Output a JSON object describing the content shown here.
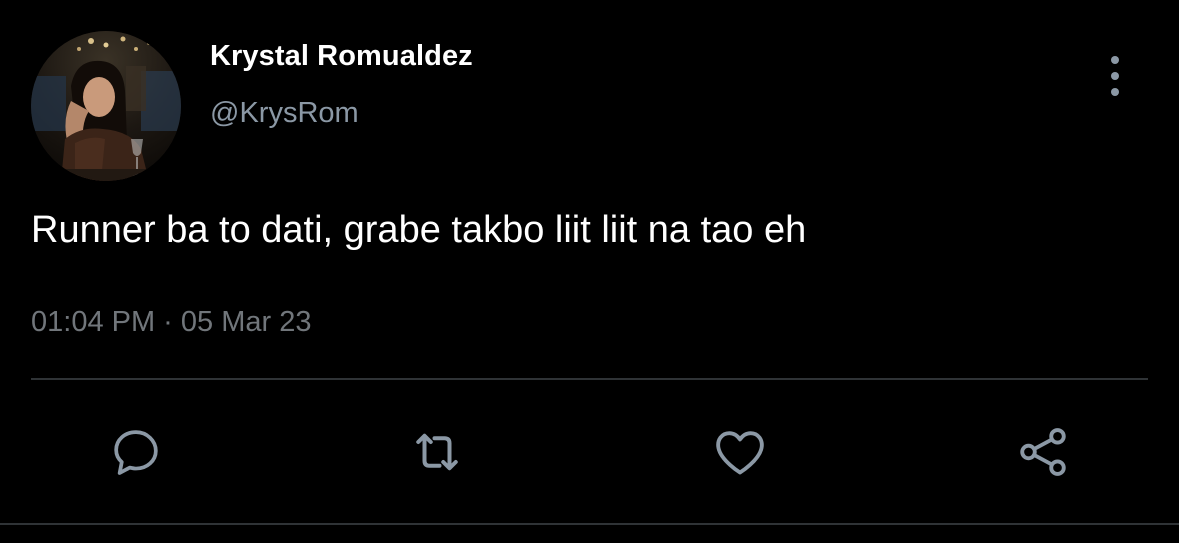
{
  "tweet": {
    "author": {
      "display_name": "Krystal Romualdez",
      "handle": "@KrysRom"
    },
    "text": "Runner ba to dati, grabe takbo liit liit na tao eh",
    "timestamp": "01:04 PM · 05 Mar 23",
    "icons": {
      "more": "more-vertical-icon",
      "reply": "reply-icon",
      "retweet": "retweet-icon",
      "like": "heart-icon",
      "share": "share-icon"
    },
    "colors": {
      "background": "#000000",
      "primary_text": "#ffffff",
      "secondary_text": "#71767b",
      "icon": "#8b98a5",
      "divider": "#2f3336"
    }
  }
}
